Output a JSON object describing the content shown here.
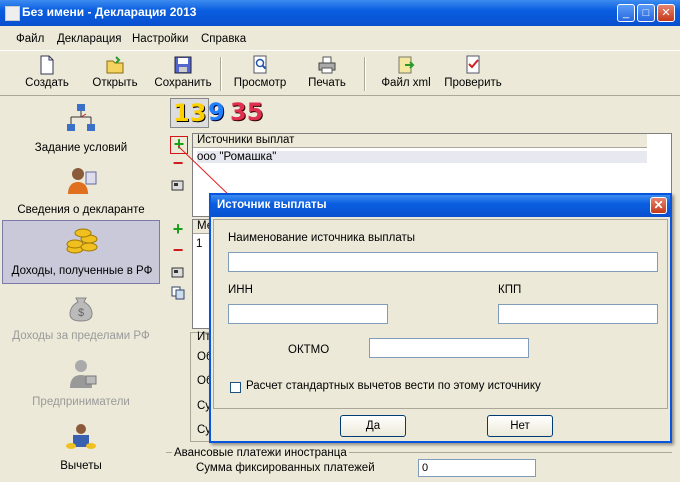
{
  "window": {
    "title": "Без имени - Декларация 2013"
  },
  "menu": [
    "Файл",
    "Декларация",
    "Настройки",
    "Справка"
  ],
  "toolbar": {
    "create": "Создать",
    "open": "Открыть",
    "save": "Сохранить",
    "preview": "Просмотр",
    "print": "Печать",
    "xml": "Файл xml",
    "check": "Проверить"
  },
  "sidebar": {
    "items": [
      {
        "label": "Задание условий"
      },
      {
        "label": "Сведения о декларанте"
      },
      {
        "label": "Доходы, полученные в РФ"
      },
      {
        "label": "Доходы за пределами РФ"
      },
      {
        "label": "Предприниматели"
      },
      {
        "label": "Вычеты"
      }
    ]
  },
  "rate_tabs": [
    "13",
    "9",
    "35"
  ],
  "sources_grid": {
    "header": "Источники выплат",
    "rows": [
      "ооо \"Ромашка\""
    ]
  },
  "month_grid": {
    "header": "Ме",
    "rows": [
      "1"
    ]
  },
  "totals": {
    "header": "Ит",
    "labels": [
      "Об",
      "Об",
      "Су",
      "Су"
    ]
  },
  "advance": {
    "header": "Авансовые платежи иностранца",
    "sum_label": "Сумма фиксированных платежей",
    "sum_value": "0"
  },
  "dialog": {
    "title": "Источник выплаты",
    "name_label": "Наименование источника выплаты",
    "name_value": "",
    "inn_label": "ИНН",
    "inn_value": "",
    "kpp_label": "КПП",
    "kpp_value": "",
    "oktmo_label": "ОКТМО",
    "oktmo_value": "",
    "checkbox_label": "Расчет стандартных вычетов вести по этому источнику",
    "checkbox_checked": false,
    "yes": "Да",
    "no": "Нет"
  }
}
